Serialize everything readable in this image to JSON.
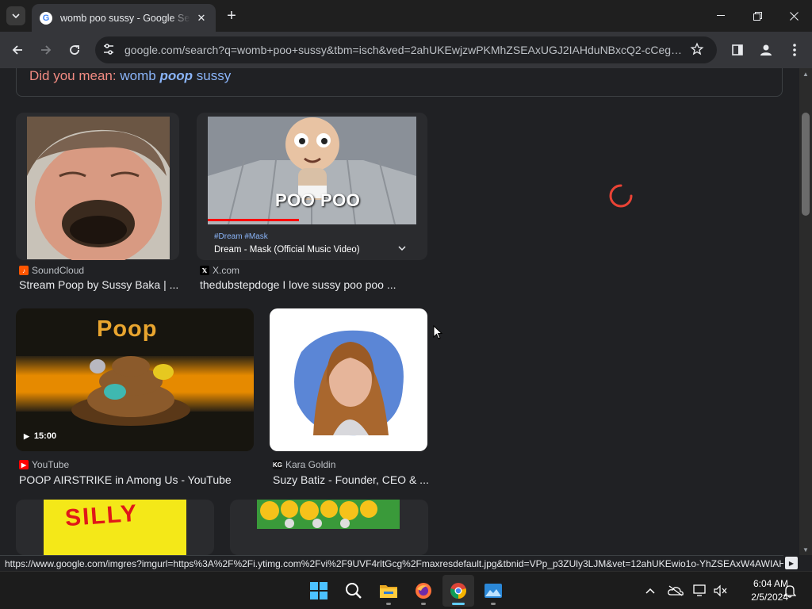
{
  "browser": {
    "tab_title": "womb poo sussy - Google Search",
    "url": "google.com/search?q=womb+poo+sussy&tbm=isch&ved=2ahUKEwjzwPKMhZSEAxUGJ2IAHduNBxcQ2-cCegQl...",
    "status_url": "https://www.google.com/imgres?imgurl=https%3A%2F%2Fi.ytimg.com%2Fvi%2F9UVF4rltGcg%2Fmaxresdefault.jpg&tbnid=VPp_p3ZUly3LJM&vet=12ahUKEwio1o-YhZSEAxW4AWIAH..."
  },
  "search": {
    "did_you_mean_label": "Did you mean:",
    "suggestion_word1": "womb",
    "suggestion_word2": "poop",
    "suggestion_word3": "sussy"
  },
  "results": [
    {
      "source": "SoundCloud",
      "title": "Stream Poop by Sussy Baka | ..."
    },
    {
      "source": "X.com",
      "title": "thedubstepdoge I love sussy poo poo ...",
      "thumb_caption": "POO POO",
      "hashtags": "#Dream #Mask",
      "video_title": "Dream - Mask (Official Music Video)"
    },
    {
      "source": "YouTube",
      "title": "POOP AIRSTRIKE in Among Us - YouTube",
      "thumb_caption": "Poop",
      "duration": "15:00"
    },
    {
      "source": "Kara Goldin",
      "title": "Suzy Batiz - Founder, CEO & ...",
      "source_badge": "KG"
    }
  ],
  "bottom_thumbs": [
    {
      "caption": "SILLY"
    },
    {
      "caption": ""
    }
  ],
  "system": {
    "time": "6:04 AM",
    "date": "2/5/2024"
  },
  "colors": {
    "accent": "#8ab4f8",
    "did_you_mean": "#f28b82",
    "spinner": "#ea4335"
  },
  "icons": [
    "tab-search-icon",
    "google-g-icon",
    "close-icon",
    "plus-icon",
    "minimize-icon",
    "restore-icon",
    "back-icon",
    "forward-icon",
    "reload-icon",
    "site-info-icon",
    "star-icon",
    "sidepanel-icon",
    "profile-icon",
    "menu-icon",
    "windows-start-icon",
    "search-icon",
    "file-explorer-icon",
    "firefox-icon",
    "chrome-icon",
    "photos-icon",
    "chevron-up-icon",
    "onedrive-icon",
    "network-icon",
    "volume-icon",
    "bell-icon"
  ]
}
